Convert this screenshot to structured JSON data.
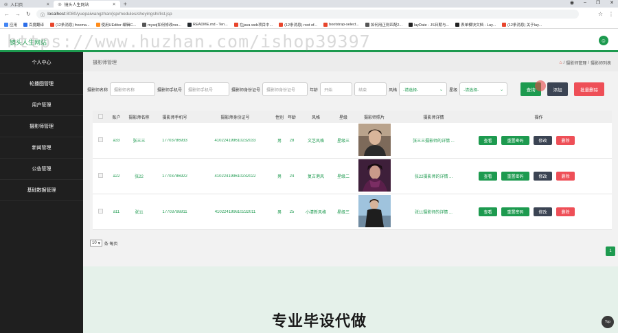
{
  "browser": {
    "tabs": [
      {
        "title": "入口页",
        "active": false
      },
      {
        "title": "镜头人生网站",
        "active": true
      }
    ],
    "url_host": "localhost",
    "url_rest": ":8080/yuepaiwangzhan/jsp/modules/sheyingshi/list.jsp",
    "bookmarks": [
      {
        "label": "应用",
        "color": "#4285f4"
      },
      {
        "label": "百度翻译",
        "color": "#2b6de8"
      },
      {
        "label": "(12条消息) freema...",
        "color": "#e8452c"
      },
      {
        "label": "使用UEditor 编辑C...",
        "color": "#ff8c1a"
      },
      {
        "label": "mysql如何修改roo...",
        "color": "#555555"
      },
      {
        "label": "README.md - Ten...",
        "color": "#24292e"
      },
      {
        "label": "在java web项目中...",
        "color": "#e8452c"
      },
      {
        "label": "(12条消息) root of...",
        "color": "#e8452c"
      },
      {
        "label": "bootstrap-select...",
        "color": "#e8452c"
      },
      {
        "label": "如何用正则匹配2...",
        "color": "#555555"
      },
      {
        "label": "layDate - JS日期与...",
        "color": "#222222"
      },
      {
        "label": "表单模块文档 - Lay...",
        "color": "#222222"
      },
      {
        "label": "(12条消息) 关于lay...",
        "color": "#e8452c"
      }
    ]
  },
  "header": {
    "title": "镜头人生网站",
    "watermark": "https://www.huzhan.com/ishop39397"
  },
  "sidebar": {
    "items": [
      {
        "label": "个人中心"
      },
      {
        "label": "轮播图管理"
      },
      {
        "label": "用户管理"
      },
      {
        "label": "摄影师管理"
      },
      {
        "label": "新闻管理"
      },
      {
        "label": "公告管理"
      },
      {
        "label": "基础数据管理"
      }
    ]
  },
  "page": {
    "title": "摄影师管理",
    "crumb_1": "摄影师管理",
    "crumb_sep": "/",
    "crumb_2": "摄影师列表"
  },
  "search": {
    "name_label": "摄影师名称",
    "name_placeholder": "摄影师名称",
    "phone_label": "摄影师手机号",
    "phone_placeholder": "摄影师手机号",
    "id_label": "摄影师身份证号",
    "id_placeholder": "摄影师身份证号",
    "age_label": "年龄",
    "age_start": "开始",
    "age_end": "结束",
    "style_label": "风格",
    "style_value": "-请选择-",
    "level_label": "星级",
    "level_value": "-请选择-",
    "query_btn": "查询",
    "add_btn": "添加",
    "batch_delete_btn": "批量删除"
  },
  "table": {
    "headers": {
      "account": "账户",
      "name": "摄影师名称",
      "phone": "摄影师手机号",
      "idcard": "摄影师身份证号",
      "gender": "性别",
      "age": "年龄",
      "style": "风格",
      "level": "星级",
      "photo": "摄影师照片",
      "detail": "摄影师详情",
      "ops": "操作"
    },
    "rows": [
      {
        "account": "a33",
        "name": "张三三",
        "phone": "17703786933",
        "idcard": "410224199610232033",
        "gender": "男",
        "age": "28",
        "style": "文艺风格",
        "level": "星级三",
        "detail": "张三三摄影师的详情 ..."
      },
      {
        "account": "a22",
        "name": "张22",
        "phone": "17703786922",
        "idcard": "410224199610232022",
        "gender": "男",
        "age": "24",
        "style": "复古港风",
        "level": "星级二",
        "detail": "张22摄影师的详情 ..."
      },
      {
        "account": "a11",
        "name": "张11",
        "phone": "17703786911",
        "idcard": "410224199610232011",
        "gender": "男",
        "age": "25",
        "style": "小清新风格",
        "level": "星级三",
        "detail": "张11摄影师的详情 ..."
      }
    ],
    "op_labels": {
      "view": "查看",
      "reset": "重置密码",
      "edit": "修改",
      "delete": "删除"
    }
  },
  "pager": {
    "per_page": "10",
    "per_page_suffix": "条 每页",
    "current_page": "1"
  },
  "banner": {
    "text": "专业毕设代做",
    "top_label": "Top"
  }
}
